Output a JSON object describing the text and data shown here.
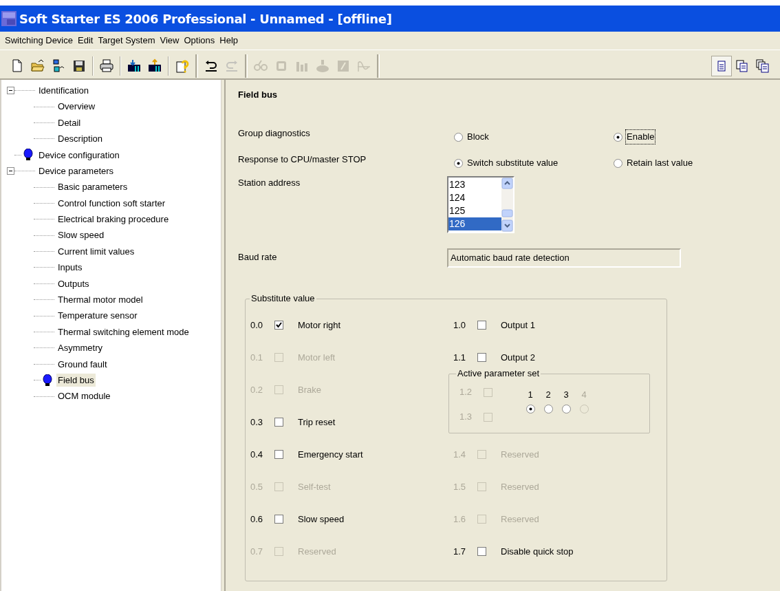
{
  "window": {
    "title": "Soft Starter ES 2006 Professional - Unnamed - [offline]"
  },
  "menu": [
    "Switching Device",
    "Edit",
    "Target System",
    "View",
    "Options",
    "Help"
  ],
  "toolbar": [
    {
      "kind": "new",
      "disabled": false
    },
    {
      "kind": "open",
      "disabled": false
    },
    {
      "kind": "transfer",
      "disabled": false
    },
    {
      "kind": "save",
      "disabled": false
    },
    {
      "kind": "sep"
    },
    {
      "kind": "print",
      "disabled": false
    },
    {
      "kind": "sep"
    },
    {
      "kind": "load_up",
      "disabled": false
    },
    {
      "kind": "load_down",
      "disabled": false
    },
    {
      "kind": "sep"
    },
    {
      "kind": "help",
      "disabled": false
    },
    {
      "kind": "bar"
    },
    {
      "kind": "undo",
      "disabled": false
    },
    {
      "kind": "redo",
      "disabled": true
    },
    {
      "kind": "bar"
    },
    {
      "kind": "glasses",
      "disabled": true
    },
    {
      "kind": "chip",
      "disabled": true
    },
    {
      "kind": "bars",
      "disabled": true
    },
    {
      "kind": "motor",
      "disabled": true
    },
    {
      "kind": "panel",
      "disabled": true
    },
    {
      "kind": "wave",
      "disabled": true
    },
    {
      "kind": "bar"
    },
    {
      "kind": "spacer"
    },
    {
      "kind": "page1",
      "disabled": false,
      "selected": true
    },
    {
      "kind": "page2",
      "disabled": false,
      "selected": false
    },
    {
      "kind": "page3",
      "disabled": false,
      "selected": false
    }
  ],
  "tree": [
    {
      "label": "Identification",
      "expanded": true,
      "bulb": false,
      "selected": false,
      "children": [
        {
          "label": "Overview",
          "bulb": false,
          "selected": false
        },
        {
          "label": "Detail",
          "bulb": false,
          "selected": false
        },
        {
          "label": "Description",
          "bulb": false,
          "selected": false
        }
      ]
    },
    {
      "label": "Device configuration",
      "bulb": true,
      "selected": false
    },
    {
      "label": "Device parameters",
      "expanded": true,
      "bulb": false,
      "selected": false,
      "children": [
        {
          "label": "Basic parameters",
          "bulb": false,
          "selected": false
        },
        {
          "label": "Control function soft starter",
          "bulb": false,
          "selected": false
        },
        {
          "label": "Electrical braking procedure",
          "bulb": false,
          "selected": false
        },
        {
          "label": "Slow speed",
          "bulb": false,
          "selected": false
        },
        {
          "label": "Current limit values",
          "bulb": false,
          "selected": false
        },
        {
          "label": "Inputs",
          "bulb": false,
          "selected": false
        },
        {
          "label": "Outputs",
          "bulb": false,
          "selected": false
        },
        {
          "label": "Thermal motor model",
          "bulb": false,
          "selected": false
        },
        {
          "label": "Temperature sensor",
          "bulb": false,
          "selected": false
        },
        {
          "label": "Thermal switching element mode",
          "bulb": false,
          "selected": false
        },
        {
          "label": "Asymmetry",
          "bulb": false,
          "selected": false
        },
        {
          "label": "Ground fault",
          "bulb": false,
          "selected": false
        },
        {
          "label": "Field bus",
          "bulb": true,
          "selected": true
        },
        {
          "label": "OCM module",
          "bulb": false,
          "selected": false
        }
      ]
    }
  ],
  "panel": {
    "heading": "Field bus",
    "radio_groups": [
      {
        "label": "Group diagnostics",
        "options": [
          {
            "label": "Block",
            "selected": false,
            "focused": false
          },
          {
            "label": "Enable",
            "selected": true,
            "focused": true
          }
        ]
      },
      {
        "label": "Response to CPU/master STOP",
        "options": [
          {
            "label": "Switch substitute value",
            "selected": true,
            "focused": false
          },
          {
            "label": "Retain last value",
            "selected": false,
            "focused": false
          }
        ]
      }
    ],
    "station_address": {
      "label": "Station address",
      "items": [
        {
          "label": "123",
          "selected": false
        },
        {
          "label": "124",
          "selected": false
        },
        {
          "label": "125",
          "selected": false
        },
        {
          "label": "126",
          "selected": true
        }
      ]
    },
    "baud_rate": {
      "label": "Baud rate",
      "value": "Automatic baud rate detection"
    },
    "substitute": {
      "title": "Substitute value",
      "left": [
        {
          "bit": "0.0",
          "label": "Motor right",
          "checked": true,
          "disabled": false
        },
        {
          "bit": "0.1",
          "label": "Motor left",
          "checked": false,
          "disabled": true
        },
        {
          "bit": "0.2",
          "label": "Brake",
          "checked": false,
          "disabled": true
        },
        {
          "bit": "0.3",
          "label": "Trip reset",
          "checked": false,
          "disabled": false
        },
        {
          "bit": "0.4",
          "label": "Emergency start",
          "checked": false,
          "disabled": false
        },
        {
          "bit": "0.5",
          "label": "Self-test",
          "checked": false,
          "disabled": true
        },
        {
          "bit": "0.6",
          "label": "Slow speed",
          "checked": false,
          "disabled": false
        },
        {
          "bit": "0.7",
          "label": "Reserved",
          "checked": false,
          "disabled": true
        }
      ],
      "right_top": [
        {
          "bit": "1.0",
          "label": "Output 1",
          "checked": false,
          "disabled": false
        },
        {
          "bit": "1.1",
          "label": "Output 2",
          "checked": false,
          "disabled": false
        }
      ],
      "parameter_set": {
        "title": "Active parameter set",
        "bits": [
          {
            "bit": "1.2",
            "checked": false,
            "disabled": true
          },
          {
            "bit": "1.3",
            "checked": false,
            "disabled": true
          }
        ],
        "options": [
          {
            "label": "1",
            "selected": true,
            "disabled": false
          },
          {
            "label": "2",
            "selected": false,
            "disabled": false
          },
          {
            "label": "3",
            "selected": false,
            "disabled": false
          },
          {
            "label": "4",
            "selected": false,
            "disabled": true
          }
        ]
      },
      "right_bottom": [
        {
          "bit": "1.4",
          "label": "Reserved",
          "checked": false,
          "disabled": true
        },
        {
          "bit": "1.5",
          "label": "Reserved",
          "checked": false,
          "disabled": true
        },
        {
          "bit": "1.6",
          "label": "Reserved",
          "checked": false,
          "disabled": true
        },
        {
          "bit": "1.7",
          "label": "Disable quick stop",
          "checked": false,
          "disabled": false
        }
      ]
    }
  }
}
